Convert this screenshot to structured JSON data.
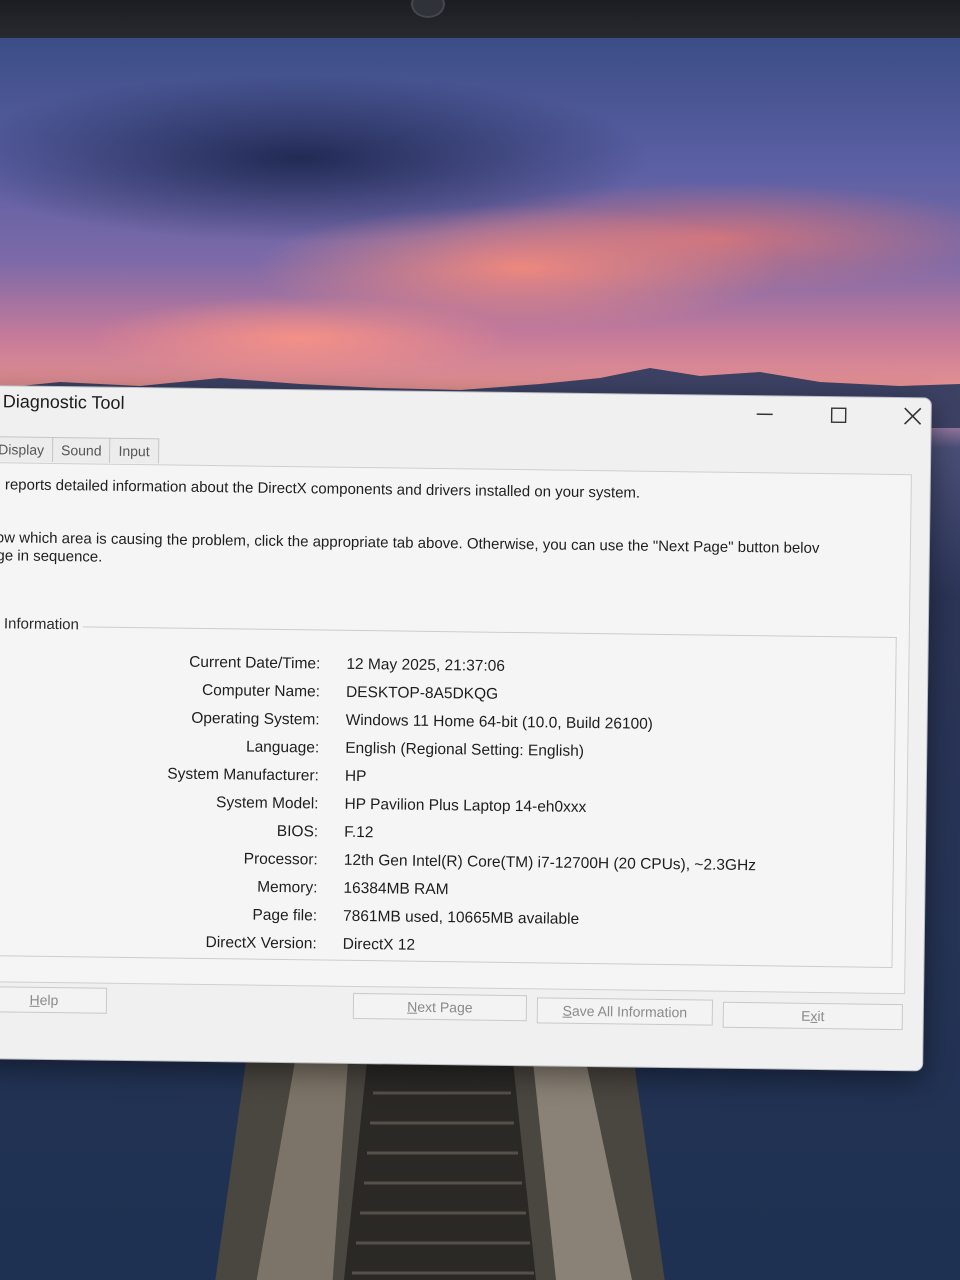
{
  "window": {
    "title": "tX Diagnostic Tool",
    "controls": {
      "minimize": "minimize-icon",
      "maximize": "maximize-icon",
      "close": "close-icon"
    }
  },
  "tabs": [
    "Display",
    "Sound",
    "Input"
  ],
  "intro": {
    "line1": "ool reports detailed information about the DirectX components and drivers installed on your system.",
    "line2": "know which area is causing the problem, click the appropriate tab above. Otherwise, you can use the \"Next Page\" button belov",
    "line3": "page in sequence."
  },
  "system_info": {
    "group_label": "em Information",
    "rows": [
      {
        "label": "Current Date/Time:",
        "value": "12 May 2025, 21:37:06"
      },
      {
        "label": "Computer Name:",
        "value": "DESKTOP-8A5DKQG"
      },
      {
        "label": "Operating System:",
        "value": "Windows 11 Home 64-bit (10.0, Build 26100)"
      },
      {
        "label": "Language:",
        "value": "English (Regional Setting: English)"
      },
      {
        "label": "System Manufacturer:",
        "value": "HP"
      },
      {
        "label": "System Model:",
        "value": "HP Pavilion Plus Laptop 14-eh0xxx"
      },
      {
        "label": "BIOS:",
        "value": "F.12"
      },
      {
        "label": "Processor:",
        "value": "12th Gen Intel(R) Core(TM) i7-12700H (20 CPUs), ~2.3GHz"
      },
      {
        "label": "Memory:",
        "value": "16384MB RAM"
      },
      {
        "label": "Page file:",
        "value": "7861MB used, 10665MB available"
      },
      {
        "label": "DirectX Version:",
        "value": "DirectX 12"
      }
    ]
  },
  "buttons": {
    "help": {
      "first": "H",
      "rest": "elp"
    },
    "next_page": {
      "first": "N",
      "rest": "ext Page"
    },
    "save_all": {
      "first": "S",
      "rest": "ave All Information"
    },
    "exit": {
      "before": "E",
      "u": "x",
      "after": "it"
    }
  },
  "colors": {
    "wallpaper_sunset": "#e9958f",
    "window_bg": "#f0f0f0",
    "disabled_text": "#8a8a8a"
  }
}
